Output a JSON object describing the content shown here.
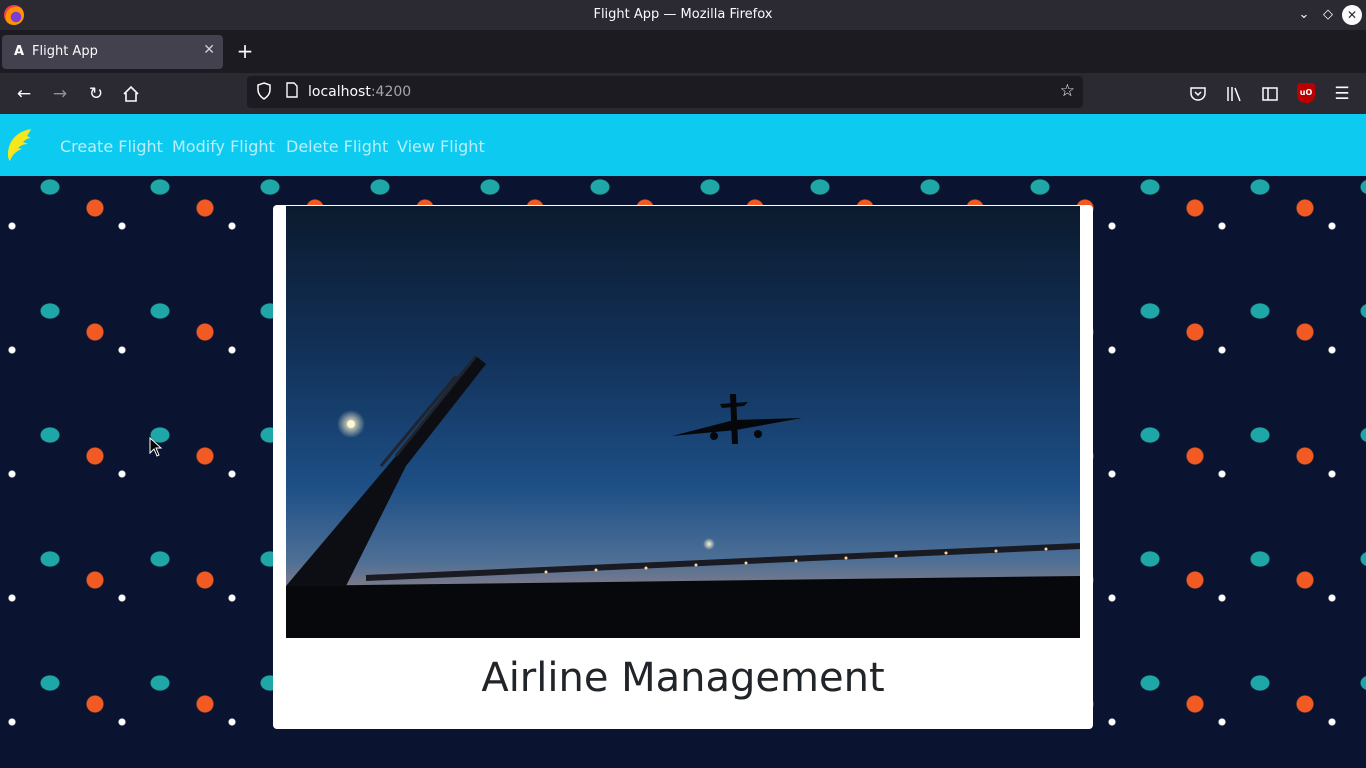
{
  "window": {
    "title": "Flight App — Mozilla Firefox"
  },
  "tabs": [
    {
      "label": "Flight App",
      "favicon": "angular-icon"
    }
  ],
  "toolbar": {
    "url_host": "localhost",
    "url_port": ":4200"
  },
  "app": {
    "brand_logo": "flight-logo-icon",
    "nav": [
      {
        "label": "Create Flight"
      },
      {
        "label": "Modify Flight"
      },
      {
        "label": "Delete Flight"
      },
      {
        "label": "View Flight"
      }
    ],
    "heading": "Airline Management",
    "hero_image": "airplane-at-dusk-photo"
  },
  "colors": {
    "navbar": "#0dcaf0",
    "page_background": "#0a1430",
    "card": "#ffffff"
  }
}
